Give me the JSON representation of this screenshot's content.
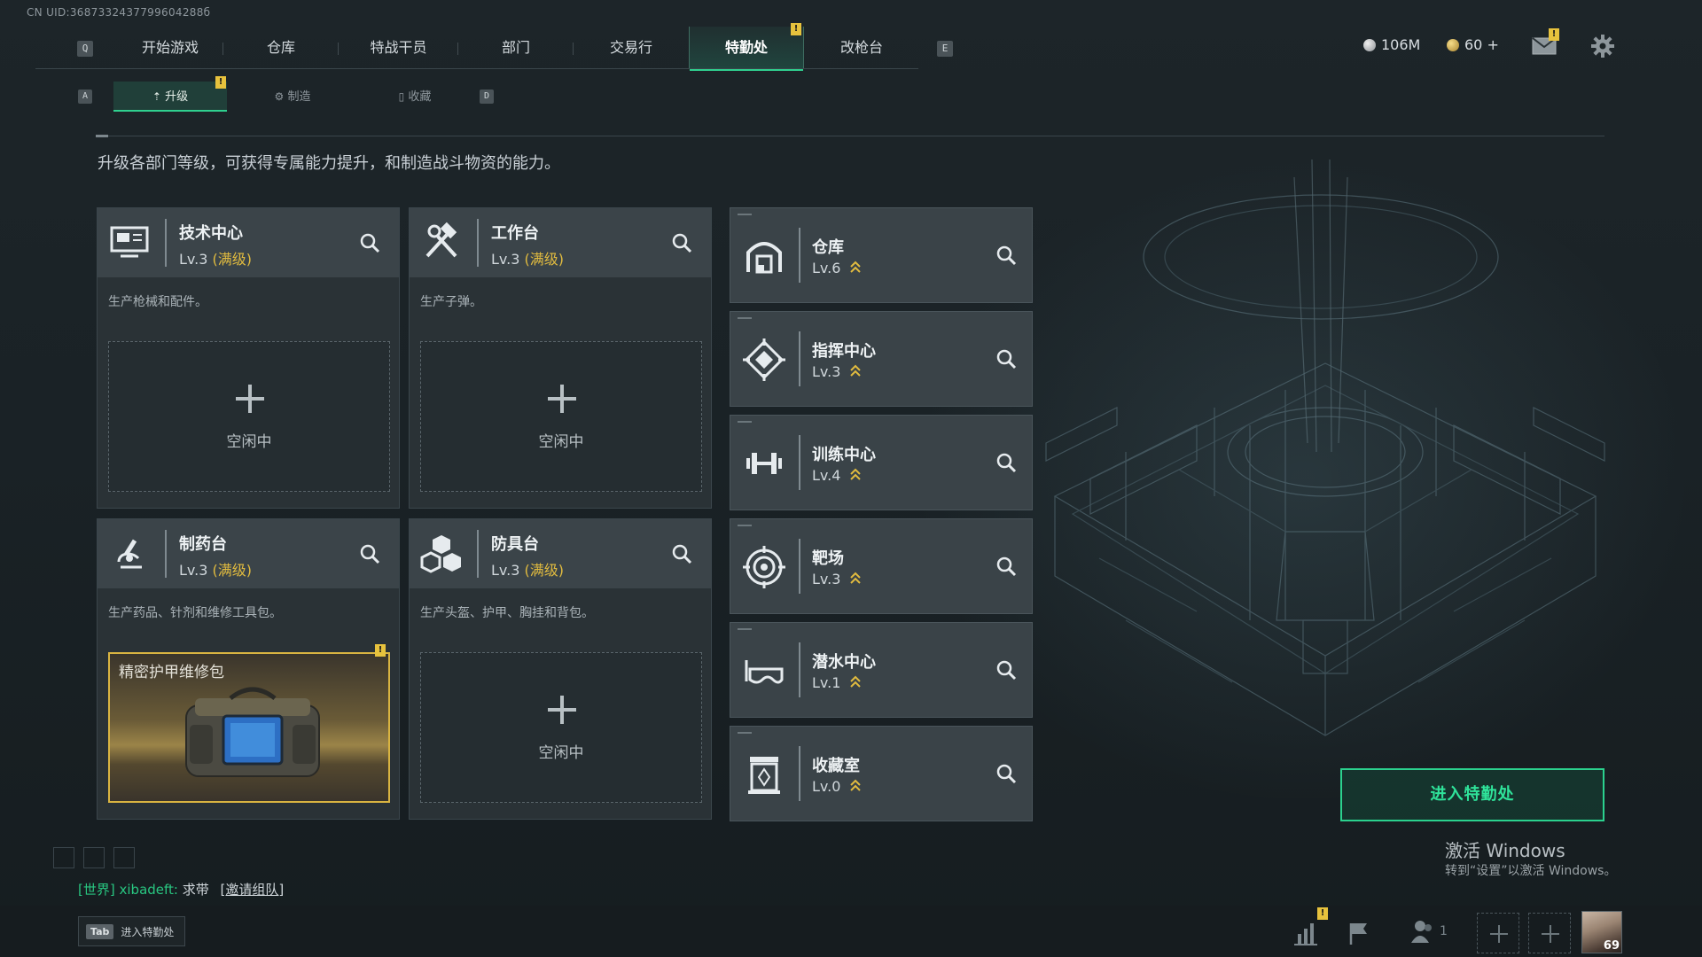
{
  "header": {
    "uid": "CN UID:3687332437799604288б",
    "left_key": "Q",
    "right_key": "E",
    "nav_tabs": [
      {
        "label": "开始游戏"
      },
      {
        "label": "仓库"
      },
      {
        "label": "特战干员"
      },
      {
        "label": "部门"
      },
      {
        "label": "交易行"
      },
      {
        "label": "特勤处",
        "active": true,
        "alert": true
      },
      {
        "label": "改枪台"
      }
    ],
    "currency_silver": "106M",
    "currency_gold": "60 +",
    "alert_glyph": "!",
    "icons": {
      "mail": "mail-icon",
      "settings": "gear-icon"
    }
  },
  "subnav": {
    "left_key": "A",
    "right_key": "D",
    "tabs": [
      {
        "label": "升级",
        "active": true,
        "alert": true
      },
      {
        "label": "制造"
      },
      {
        "label": "收藏"
      }
    ]
  },
  "description": "升级各部门等级，可获得专属能力提升，和制造战斗物资的能力。",
  "production": [
    {
      "name": "技术中心",
      "level": "Lv.3",
      "status": "(满级)",
      "desc": "生产枪械和配件。",
      "slot": "空闲中",
      "icon": "computer-icon"
    },
    {
      "name": "工作台",
      "level": "Lv.3",
      "status": "(满级)",
      "desc": "生产子弹。",
      "slot": "空闲中",
      "icon": "hammer-wrench-icon"
    },
    {
      "name": "制药台",
      "level": "Lv.3",
      "status": "(满级)",
      "desc": "生产药品、针剂和维修工具包。",
      "slot_item": "精密护甲维修包",
      "icon": "microscope-icon"
    },
    {
      "name": "防具台",
      "level": "Lv.3",
      "status": "(满级)",
      "desc": "生产头盔、护甲、胸挂和背包。",
      "slot": "空闲中",
      "icon": "cubes-icon"
    }
  ],
  "departments": [
    {
      "name": "仓库",
      "level": "Lv.6",
      "icon": "warehouse-icon"
    },
    {
      "name": "指挥中心",
      "level": "Lv.3",
      "icon": "command-icon"
    },
    {
      "name": "训练中心",
      "level": "Lv.4",
      "icon": "dumbbell-icon"
    },
    {
      "name": "靶场",
      "level": "Lv.3",
      "icon": "target-icon"
    },
    {
      "name": "潜水中心",
      "level": "Lv.1",
      "icon": "diving-goggles-icon"
    },
    {
      "name": "收藏室",
      "level": "Lv.0",
      "icon": "collection-icon"
    }
  ],
  "enter_button": "进入特勤处",
  "watermark": {
    "line1": "激活 Windows",
    "line2": "转到“设置”以激活 Windows。"
  },
  "chat": {
    "channel": "[世界]",
    "user": "xibadeft:",
    "message": "求带",
    "link": "[邀请组队]"
  },
  "footer": {
    "tab_key": "Tab",
    "tab_label": "进入特勤处",
    "friends_count": "1",
    "avatar_level": "69"
  },
  "colors": {
    "accent": "#2fd08f",
    "gold": "#e1bb3f",
    "alert": "#e7c23d"
  }
}
